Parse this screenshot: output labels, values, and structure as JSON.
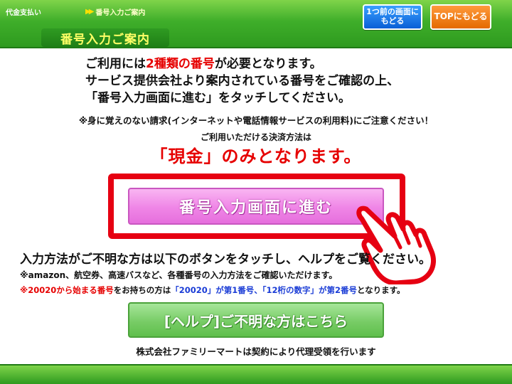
{
  "header": {
    "home_crumb": "代金支払い",
    "current_crumb": "番号入力ご案内",
    "page_title": "番号入力ご案内",
    "back_button_line1": "1つ前の画面に",
    "back_button_line2": "もどる",
    "top_button": "TOPにもどる"
  },
  "intro": {
    "line1_prefix": "ご利用には",
    "line1_highlight": "2種類の番号",
    "line1_suffix": "が必要となります。",
    "line2": "サービス提供会社より案内されている番号をご確認の上、",
    "line3": "「番号入力画面に進む」をタッチしてください。"
  },
  "caution": "※身に覚えのない請求(インターネットや電話情報サービスの利用料)にご注意ください！",
  "payment": {
    "label": "ご利用いただける決済方法は",
    "method": "「現金」のみとなります。"
  },
  "proceed_button": "番号入力画面に進む",
  "help": {
    "lead": "入力方法がご不明な方は以下のボタンをタッチし、ヘルプをご覧ください。",
    "note1": "※amazon、航空券、高速バスなど、各種番号の入力方法をご確認いただけます。",
    "note2_prefix": "※",
    "note2_red": "20020から始まる番号",
    "note2_mid": "をお持ちの方は",
    "note2_blue": "「20020」が第1番号、「12桁の数字」が第2番号",
    "note2_suffix": "となります。",
    "button": "[ヘルプ]ご不明な方はこちら"
  },
  "footer_note": "株式会社ファミリーマートは契約により代理受領を行います",
  "colors": {
    "brand_green": "#2e9a1f",
    "accent_red": "#e60000",
    "proceed_pink": "#ef85e6",
    "help_green": "#78cc66",
    "back_blue": "#0a5fd6",
    "top_orange": "#e46a00"
  },
  "icons": {
    "pointer": "pointing-hand-icon",
    "crumb_separator": "double-chevron-icon"
  }
}
